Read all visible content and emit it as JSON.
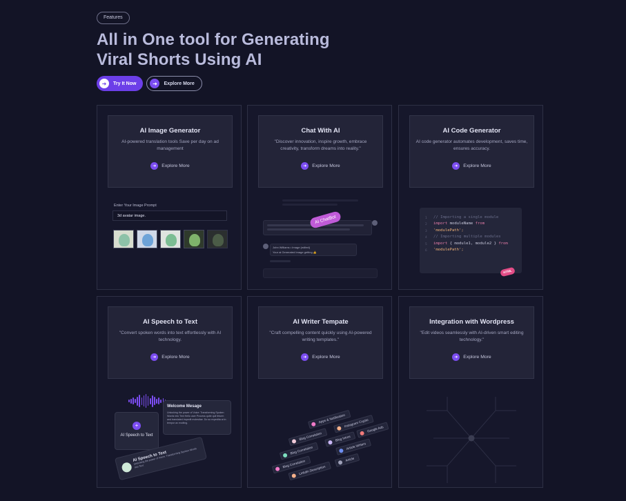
{
  "header": {
    "badge": "Features",
    "title_line1": "All in One tool for Generating",
    "title_line2": "Viral Shorts Using AI",
    "primary_button": "Try It Now",
    "secondary_button": "Explore More"
  },
  "cards": [
    {
      "title": "AI Image Generator",
      "desc": "AI-powered translation tools Save per day on ad management",
      "link": "Explore More"
    },
    {
      "title": "Chat With AI",
      "desc": "\"Discover innovation, inspire growth, embrace creativity, transform dreams into reality.\"",
      "link": "Explore More"
    },
    {
      "title": "AI Code Generator",
      "desc": "AI code generator automates development, saves time, ensures accuracy.",
      "link": "Explore More"
    },
    {
      "title": "AI Speech to Text",
      "desc": "\"Convert spoken words into text effortlessly with AI technology.",
      "link": "Explore More"
    },
    {
      "title": "AI Writer Tempate",
      "desc": "\"Craft compelling content quickly using AI-powered writing templates.\"",
      "link": "Explore More"
    },
    {
      "title": "Integration with Wordpress",
      "desc": "\"Edit videos seamlessly with AI-driven smart editing technology.\"",
      "link": "Explore More"
    }
  ],
  "image_gen": {
    "prompt_label": "Enter Your Image Prompt",
    "prompt_value": "3d avatar image."
  },
  "chat": {
    "badge": "AI ChatBot",
    "user_name": "John Williams",
    "user_meta": "• Image (edited)",
    "user_msg": "Your ai Generated Image getting 👍"
  },
  "code": {
    "line1": "// Importing a single module",
    "line2_kw": "import",
    "line2_name": " moduleName ",
    "line2_kw2": "from",
    "line3": "'modulePath';",
    "line4": "// Importing multiple modules",
    "line5_kw": "import",
    "line5_name": " { module1, module2 } ",
    "line5_kw2": "from",
    "line6": "'modulePath';",
    "badge": "HTML"
  },
  "speech": {
    "box_label": "AI Speech to Text",
    "welcome_title": "Welcome Mesage",
    "welcome_body": "Unlocking the power of Voice: Transforming Spoken Words into Text Hello user Process quite quil feturm and translated impedit molestiae. Do so expedita at in tempor ax exciting.",
    "card_title": "AI Speech to Text",
    "card_body": "Unlocking the power of Voice: Transforming Spoken Words into Text"
  },
  "writer_chips": [
    {
      "label": "Apps & Notification",
      "color": "#f07ac8"
    },
    {
      "label": "Blog Correlation",
      "color": "#f0c9d8"
    },
    {
      "label": "Instagram Crypto",
      "color": "#f5b08a"
    },
    {
      "label": "Blog Correlation",
      "color": "#7ee0c0"
    },
    {
      "label": "Blog Intros",
      "color": "#c9b6f5"
    },
    {
      "label": "Google Ads",
      "color": "#f07a7a"
    },
    {
      "label": "Blog Correlation",
      "color": "#f07ac8"
    },
    {
      "label": "Article Writers",
      "color": "#6d8df0"
    },
    {
      "label": "Linkdin Description",
      "color": "#f5b08a"
    },
    {
      "label": "Article",
      "color": "#9ea0b8"
    }
  ]
}
